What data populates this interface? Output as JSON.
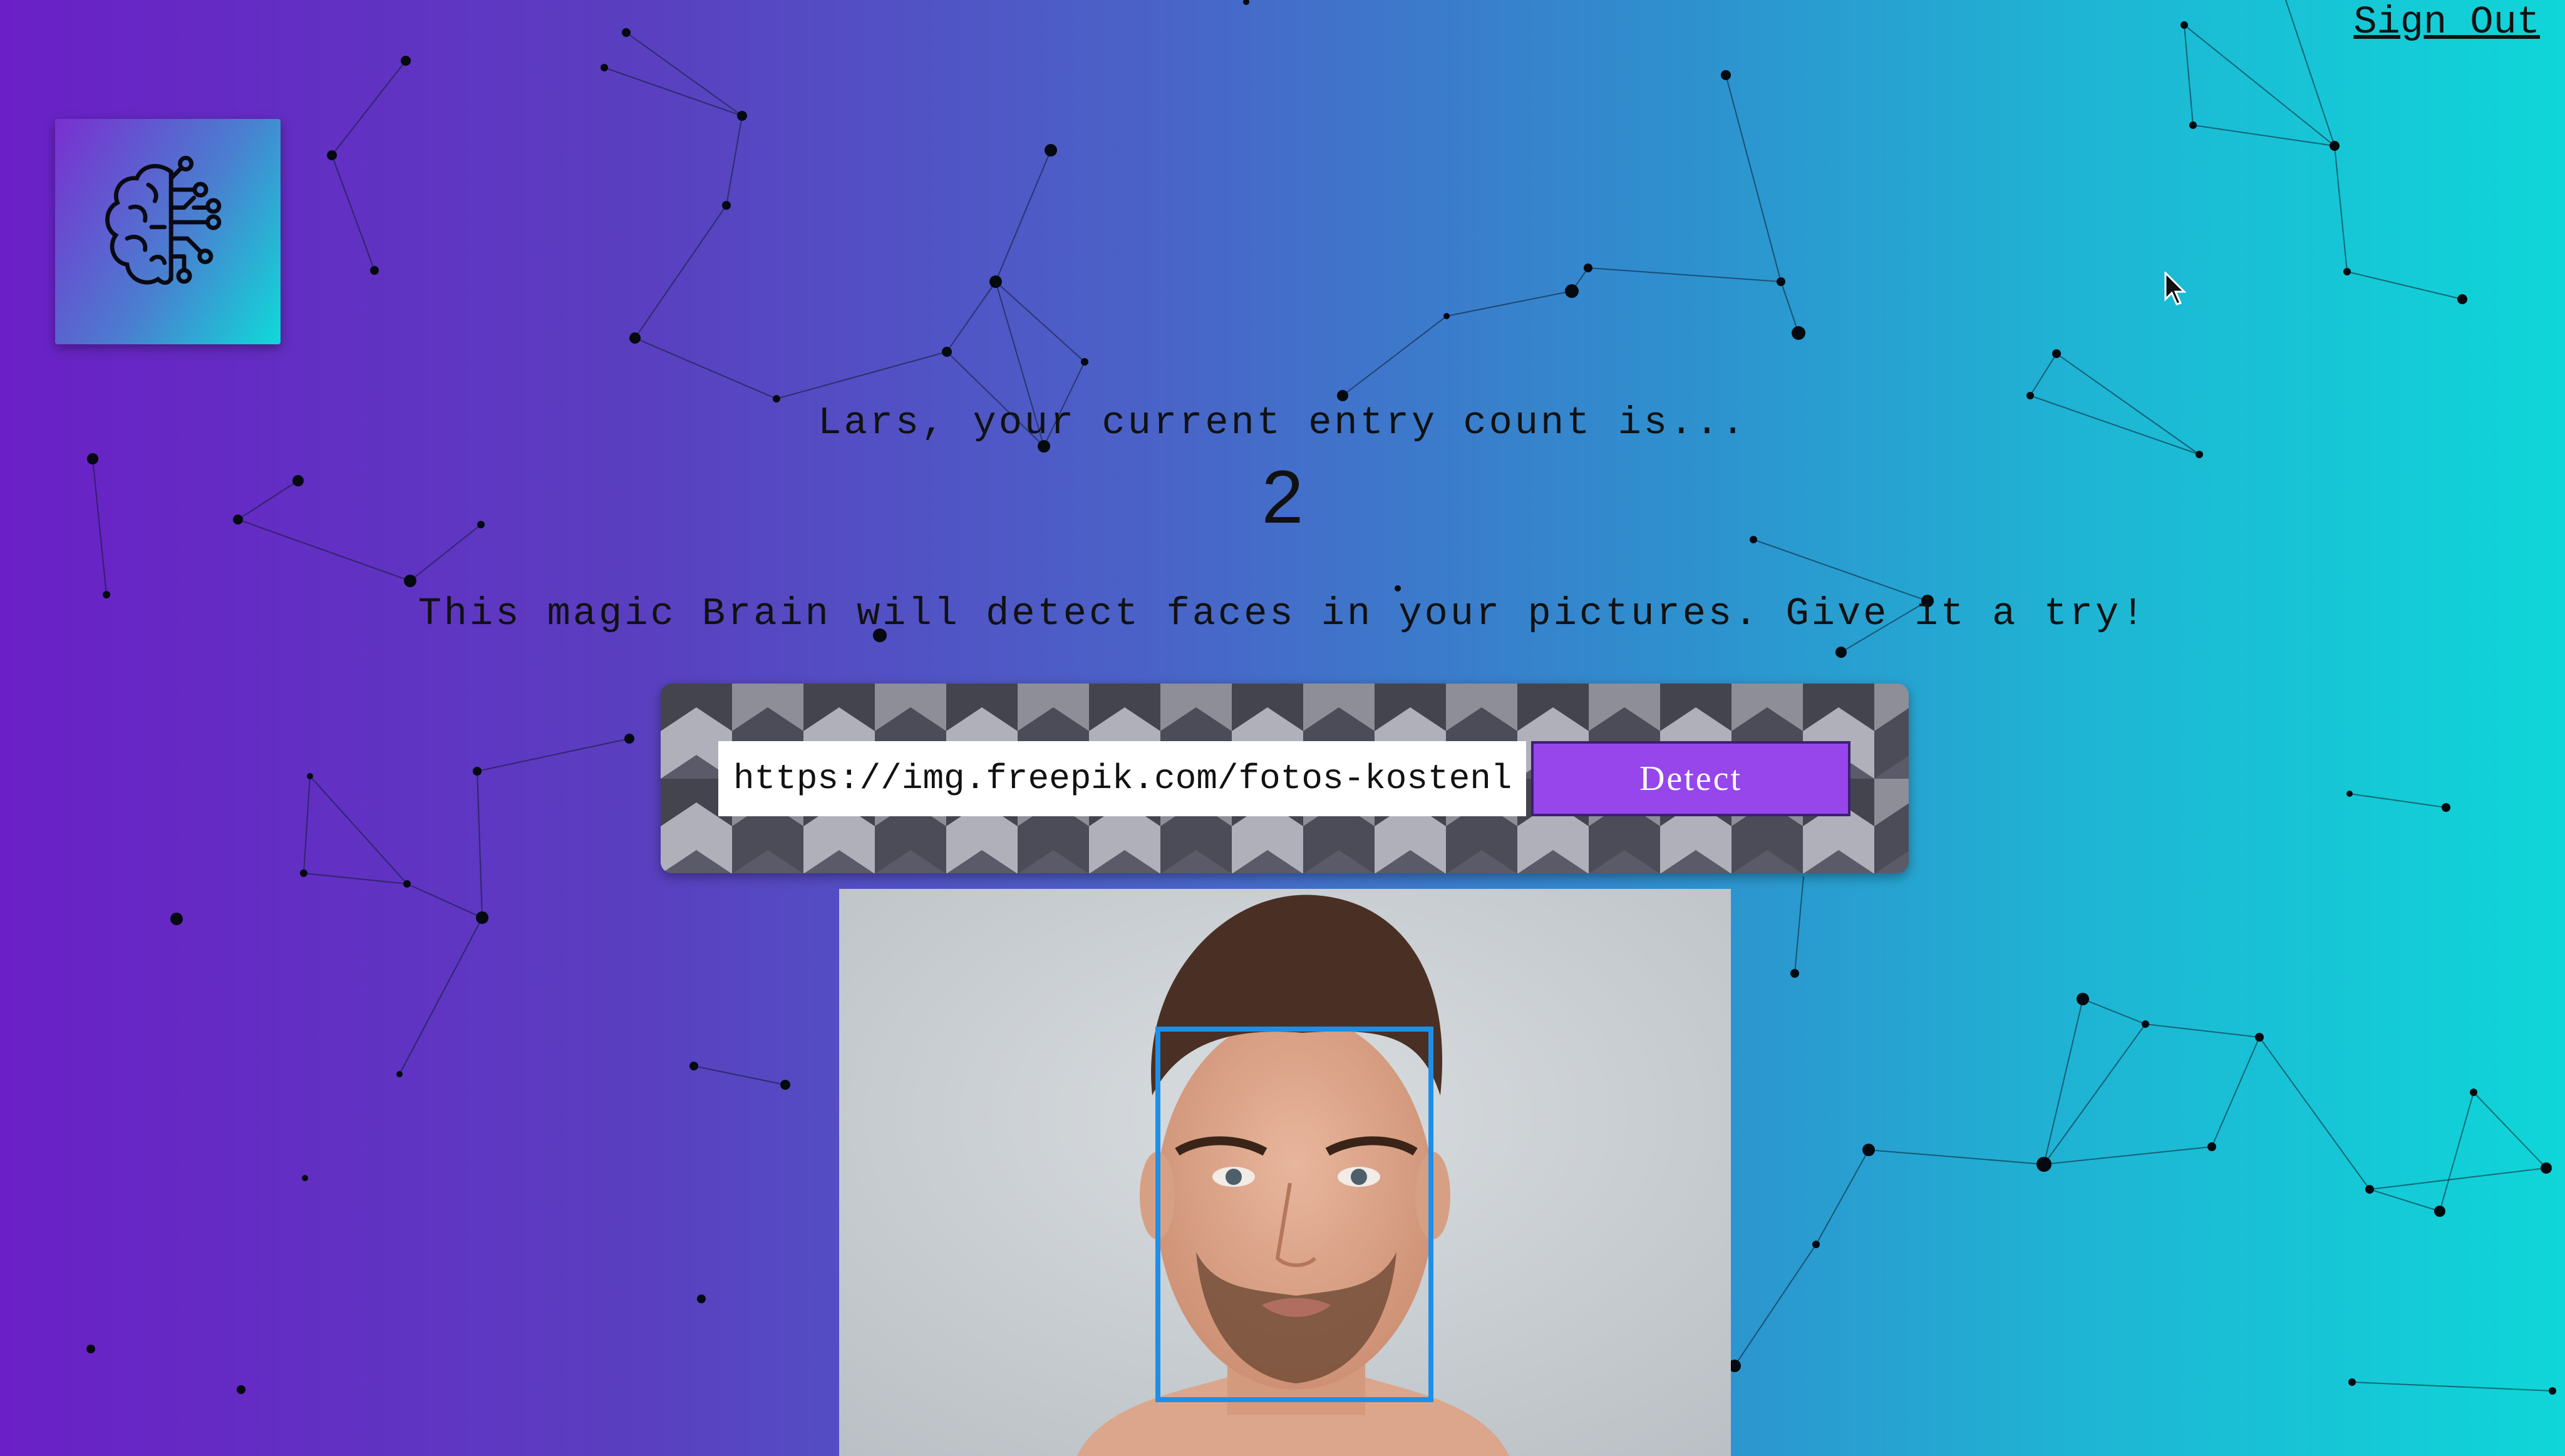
{
  "header": {
    "sign_out_label": "Sign Out"
  },
  "logo": {
    "icon": "brain-circuit-icon"
  },
  "rank": {
    "greeting": "Lars, your current entry count is...",
    "entries": "2"
  },
  "tagline": "This magic Brain will detect faces in your pictures. Give it a try!",
  "form": {
    "url_value": "https://img.freepik.com/fotos-kostenl",
    "detect_label": "Detect"
  },
  "result": {
    "image": "man-portrait-photo",
    "face_count": 1
  },
  "colors": {
    "gradient_start": "#6a20c6",
    "gradient_end": "#0fd6d8",
    "button": "#9646ea",
    "face_box": "#1d8fe9"
  }
}
